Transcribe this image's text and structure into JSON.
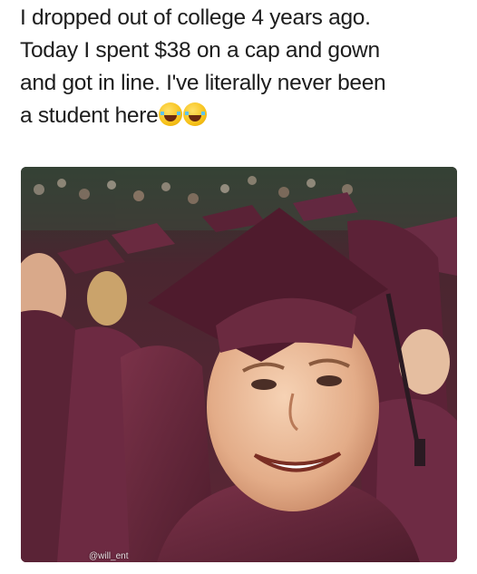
{
  "caption": {
    "lines": [
      "I dropped out of college 4 years ago.",
      "Today I spent $38 on a cap and gown",
      "and got in line. I've literally never been",
      "a student here"
    ],
    "emoji": "face-with-tears-of-joy"
  },
  "photo": {
    "watermark": "@will_ent"
  },
  "colors": {
    "gown_maroon": "#6e2c43",
    "background": "#ffffff",
    "text": "#1d1d1d"
  }
}
